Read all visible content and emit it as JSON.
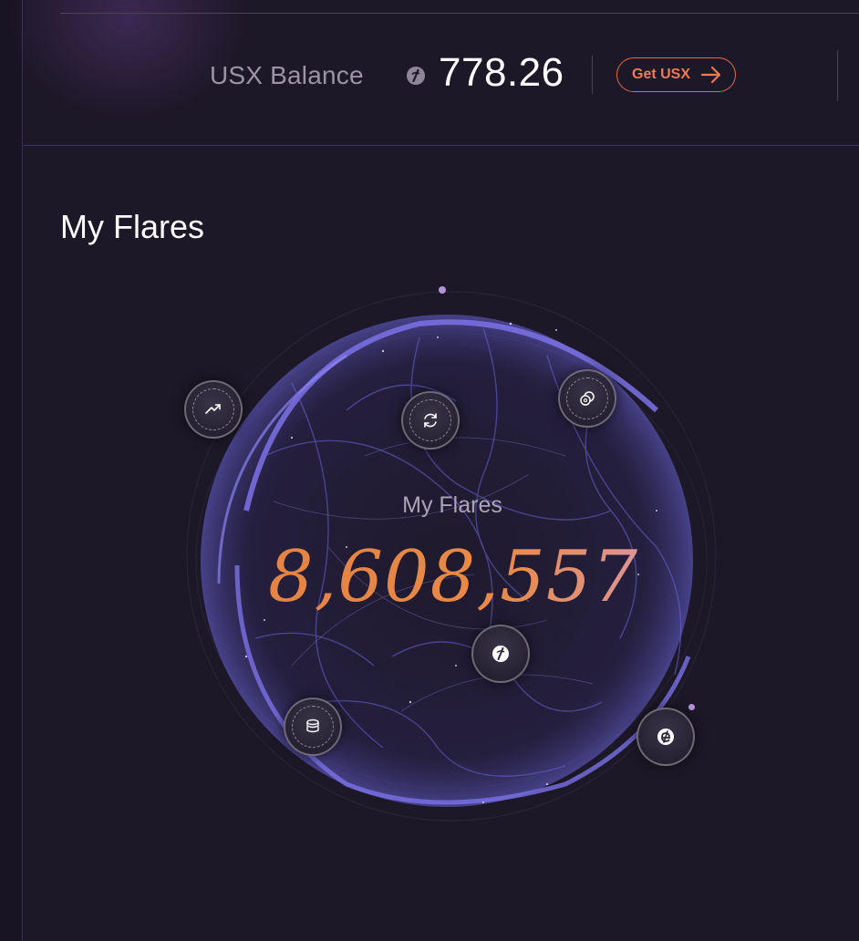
{
  "balance": {
    "label": "USX Balance",
    "value": "778.26",
    "currency_icon": "usx-coin-icon",
    "cta_label": "Get USX",
    "cta_icon": "arrow-right-icon"
  },
  "section": {
    "title": "My Flares"
  },
  "flares": {
    "label": "My Flares",
    "value": "8,608,557"
  },
  "nodes": [
    {
      "icon": "trending-up-icon"
    },
    {
      "icon": "refresh-icon"
    },
    {
      "icon": "coins-icon"
    },
    {
      "icon": "usx-coin-icon"
    },
    {
      "icon": "stack-icon"
    },
    {
      "icon": "e-token-icon"
    }
  ],
  "colors": {
    "background": "#1d1828",
    "accent": "#f07a52",
    "globe": "#6a63d8",
    "number_gradient": [
      "#e07a3e",
      "#d89ab8",
      "#9cc8e6"
    ]
  }
}
